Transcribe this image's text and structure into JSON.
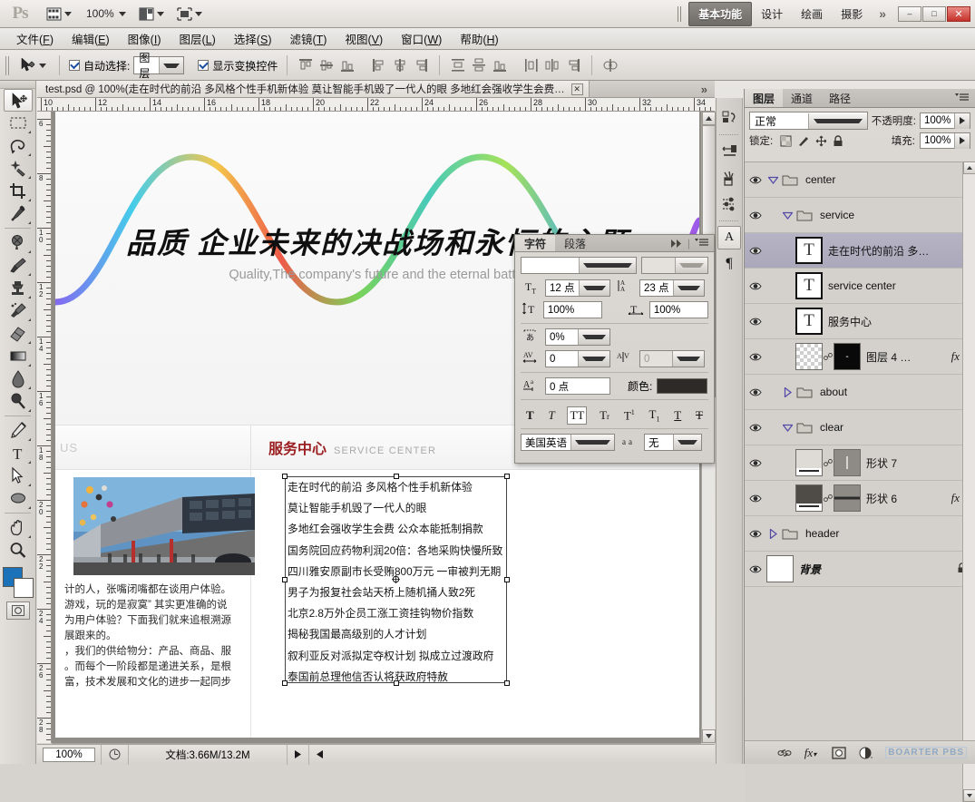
{
  "app": {
    "name": "Ps",
    "zoom_level": "100%"
  },
  "workspace": {
    "tabs": [
      {
        "label": "基本功能",
        "active": true
      },
      {
        "label": "设计",
        "active": false
      },
      {
        "label": "绘画",
        "active": false
      },
      {
        "label": "摄影",
        "active": false
      }
    ],
    "more": "»",
    "window_buttons": {
      "minimize": "–",
      "maximize": "□",
      "close": "✕"
    }
  },
  "menubar": [
    {
      "label": "文件",
      "accel": "F"
    },
    {
      "label": "编辑",
      "accel": "E"
    },
    {
      "label": "图像",
      "accel": "I"
    },
    {
      "label": "图层",
      "accel": "L"
    },
    {
      "label": "选择",
      "accel": "S"
    },
    {
      "label": "滤镜",
      "accel": "T"
    },
    {
      "label": "视图",
      "accel": "V"
    },
    {
      "label": "窗口",
      "accel": "W"
    },
    {
      "label": "帮助",
      "accel": "H"
    }
  ],
  "options_bar": {
    "tool": "move-tool",
    "auto_select_label": "自动选择:",
    "auto_select_checked": true,
    "auto_select_value": "图层",
    "show_transform_label": "显示变换控件",
    "show_transform_checked": true,
    "align_icons": [
      "align-top-edges",
      "align-vertical-centers",
      "align-bottom-edges",
      "align-left-edges",
      "align-horizontal-centers",
      "align-right-edges"
    ],
    "distribute_icons": [
      "distribute-top-edges",
      "distribute-vertical-centers",
      "distribute-bottom-edges",
      "distribute-left-edges",
      "distribute-horizontal-centers",
      "distribute-right-edges"
    ],
    "auto_align_icon": "auto-align-layers"
  },
  "toolbox": [
    {
      "name": "move-tool",
      "selected": true,
      "more": false
    },
    {
      "name": "rectangular-marquee-tool",
      "selected": false,
      "more": true
    },
    {
      "name": "lasso-tool",
      "selected": false,
      "more": true
    },
    {
      "name": "quick-selection-tool",
      "selected": false,
      "more": true
    },
    {
      "name": "crop-tool",
      "selected": false,
      "more": true
    },
    {
      "name": "eyedropper-tool",
      "selected": false,
      "more": true
    },
    {
      "name": "spot-healing-brush-tool",
      "selected": false,
      "more": true
    },
    {
      "name": "brush-tool",
      "selected": false,
      "more": true
    },
    {
      "name": "clone-stamp-tool",
      "selected": false,
      "more": true
    },
    {
      "name": "history-brush-tool",
      "selected": false,
      "more": true
    },
    {
      "name": "eraser-tool",
      "selected": false,
      "more": true
    },
    {
      "name": "gradient-tool",
      "selected": false,
      "more": true
    },
    {
      "name": "blur-tool",
      "selected": false,
      "more": true
    },
    {
      "name": "dodge-tool",
      "selected": false,
      "more": true
    },
    {
      "name": "pen-tool",
      "selected": false,
      "more": true
    },
    {
      "name": "horizontal-type-tool",
      "selected": false,
      "more": true
    },
    {
      "name": "path-selection-tool",
      "selected": false,
      "more": true
    },
    {
      "name": "ellipse-shape-tool",
      "selected": false,
      "more": true
    },
    {
      "name": "hand-tool",
      "selected": false,
      "more": true
    },
    {
      "name": "zoom-tool",
      "selected": false,
      "more": false
    }
  ],
  "color_controls": {
    "foreground": "#1b72b8",
    "background": "#ffffff",
    "quick_mask": "quick-mask-mode"
  },
  "document": {
    "tab_title": "test.psd @ 100%(走在时代的前沿 多风格个性手机新体验 莫让智能手机毁了一代人的眼 多地红会强收学生会费…",
    "tabs_overflow": "»",
    "close": "✕",
    "h_ruler_labels": [
      "10",
      "12",
      "14",
      "16",
      "18",
      "20",
      "22",
      "24",
      "26",
      "28",
      "30",
      "32",
      "34"
    ],
    "v_ruler_labels": [
      "6",
      "8",
      "10",
      "12",
      "14",
      "16",
      "18",
      "20",
      "22",
      "24",
      "26",
      "28"
    ]
  },
  "canvas": {
    "banner": {
      "headline": "品质 企业未来的决战场和永恒的主题",
      "subline": "Quality,The company's future and the eternal battle"
    },
    "section": {
      "left_watermark": "US",
      "title_cn": "服务中心",
      "title_en": "SERVICE CENTER"
    },
    "left_column": {
      "image": "building-photo",
      "paragraph": [
        "计的人，张嘴闭嘴都在谈用户体验。",
        "游戏，玩的是寂寞” 其实更准确的说",
        "为用户体验？下面我们就来追根溯源",
        "展跟来的。",
        "，我们的供给物分：产品、商品、服",
        "。而每个一阶段都是递进关系，是根",
        "富，技术发展和文化的进步一起同步"
      ]
    },
    "text_box": {
      "selected": true,
      "lines": [
        "走在时代的前沿 多风格个性手机新体验",
        "莫让智能手机毁了一代人的眼",
        "多地红会强收学生会费  公众本能抵制捐款",
        "国务院回应药物利润20倍：各地采购快慢所致",
        "四川雅安原副市长受贿800万元  一审被判无期",
        "男子为报复社会站天桥上随机捅人致2死",
        "北京2.8万外企员工涨工资挂钩物价指数",
        "揭秘我国最高级别的人才计划",
        "叙利亚反对派拟定夺权计划  拟成立过渡政府",
        "泰国前总理他信否认将获政府特赦"
      ]
    }
  },
  "statusbar": {
    "zoom": "100%",
    "doc_label": "文档:3.66M/13.2M"
  },
  "character_panel": {
    "tabs": [
      {
        "label": "字符",
        "active": true
      },
      {
        "label": "段落",
        "active": false
      }
    ],
    "font_family": "",
    "font_style": "",
    "font_size": "12 点",
    "leading": "23 点",
    "vertical_scale": "100%",
    "horizontal_scale": "100%",
    "tsume": "0%",
    "tracking": "0",
    "kerning": "0",
    "baseline_shift": "0 点",
    "color_label": "颜色:",
    "color_value": "#2e2a28",
    "styles": [
      "T",
      "T",
      "TT",
      "Tr",
      "T1",
      "T1",
      "T",
      "T"
    ],
    "style_active_index": 2,
    "language": "美国英语",
    "anti_alias": "无",
    "icon_names": {
      "size": "font-size-icon",
      "leading": "leading-icon",
      "vscale": "vertical-scale-icon",
      "hscale": "horizontal-scale-icon",
      "tsume": "tsume-icon",
      "tracking": "tracking-icon",
      "kerning": "kerning-icon",
      "baseline": "baseline-shift-icon",
      "antialias": "anti-alias-icon"
    }
  },
  "vertical_dock": [
    {
      "name": "history-panel-icon",
      "active": false
    },
    {
      "name": "color-panel-icon",
      "active": false
    },
    {
      "name": "brush-panel-icon",
      "active": false
    },
    {
      "name": "adjustments-panel-icon",
      "active": false
    },
    {
      "name": "character-panel-icon",
      "active": true,
      "glyph": "A"
    },
    {
      "name": "paragraph-panel-icon",
      "active": false,
      "glyph": "¶"
    }
  ],
  "layers_panel": {
    "tabs": [
      {
        "label": "图层",
        "active": true
      },
      {
        "label": "通道",
        "active": false
      },
      {
        "label": "路径",
        "active": false
      }
    ],
    "blend_mode": "正常",
    "opacity_label": "不透明度:",
    "opacity_value": "100%",
    "lock_label": "锁定:",
    "lock_icons": [
      "lock-transparent-pixels",
      "lock-image-pixels",
      "lock-position",
      "lock-all"
    ],
    "fill_label": "填充:",
    "fill_value": "100%",
    "layers": [
      {
        "name": "center",
        "type": "group",
        "indent": 0,
        "expanded": true,
        "visible": true,
        "selected": false
      },
      {
        "name": "service",
        "type": "group",
        "indent": 1,
        "expanded": true,
        "visible": true,
        "selected": false
      },
      {
        "name": "走在时代的前沿 多…",
        "type": "text",
        "indent": 2,
        "visible": true,
        "selected": true
      },
      {
        "name": "service center",
        "type": "text",
        "indent": 2,
        "visible": true,
        "selected": false
      },
      {
        "name": "服务中心",
        "type": "text",
        "indent": 2,
        "visible": true,
        "selected": false
      },
      {
        "name": "图层 4 …",
        "type": "masked",
        "indent": 2,
        "visible": true,
        "selected": false,
        "fx": true
      },
      {
        "name": "about",
        "type": "group",
        "indent": 1,
        "expanded": false,
        "visible": true,
        "selected": false
      },
      {
        "name": "clear",
        "type": "group",
        "indent": 1,
        "expanded": true,
        "visible": true,
        "selected": false
      },
      {
        "name": "形状 7",
        "type": "shape",
        "indent": 2,
        "visible": true,
        "selected": false,
        "fx": false
      },
      {
        "name": "形状 6",
        "type": "shape",
        "indent": 2,
        "visible": true,
        "selected": false,
        "fx": true
      },
      {
        "name": "header",
        "type": "group",
        "indent": 0,
        "expanded": false,
        "visible": true,
        "selected": false
      },
      {
        "name": "背景",
        "type": "background",
        "indent": 0,
        "visible": true,
        "selected": false,
        "locked": true
      }
    ],
    "bottom_icons": [
      "link-layers-icon",
      "add-layer-style-icon",
      "add-layer-mask-icon",
      "new-adjustment-layer-icon",
      "new-group-icon",
      "new-layer-icon",
      "delete-layer-icon"
    ],
    "watermark": "BOARTER PBS"
  },
  "colors": {
    "accent_red": "#9b1f21",
    "selection_blue": "#b6b4c4",
    "chrome": "#d4d1cc"
  }
}
